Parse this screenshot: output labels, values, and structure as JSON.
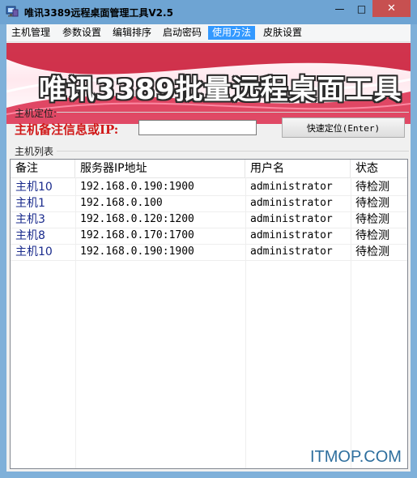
{
  "window": {
    "title": "唯讯3389远程桌面管理工具V2.5",
    "minimize": "—",
    "maximize": "□",
    "close": "✕"
  },
  "menu": {
    "items": [
      "主机管理",
      "参数设置",
      "编辑排序",
      "启动密码",
      "使用方法",
      "皮肤设置"
    ],
    "active_index": 4
  },
  "banner": {
    "title": "唯讯3389批量远程桌面工具"
  },
  "locate": {
    "section_label": "主机定位:",
    "field_label": "主机备注信息或IP:",
    "input_value": "",
    "button_label": "快速定位(Enter)"
  },
  "host_list": {
    "section_label": "主机列表",
    "columns": [
      "备注",
      "服务器IP地址",
      "用户名",
      "状态"
    ],
    "rows": [
      [
        "主机10",
        "192.168.0.190:1900",
        "administrator",
        "待检测"
      ],
      [
        "主机1",
        "192.168.0.100",
        "administrator",
        "待检测"
      ],
      [
        "主机3",
        "192.168.0.120:1200",
        "administrator",
        "待检测"
      ],
      [
        "主机8",
        "192.168.0.170:1700",
        "administrator",
        "待检测"
      ],
      [
        "主机10",
        "192.168.0.190:1900",
        "administrator",
        "待检测"
      ]
    ]
  },
  "watermark": "ITMOP.COM",
  "colors": {
    "title_bar": "#6ea4d3",
    "menu_active": "#3399ff",
    "locate_label": "#d01818",
    "note_text": "#1a2b8c"
  }
}
